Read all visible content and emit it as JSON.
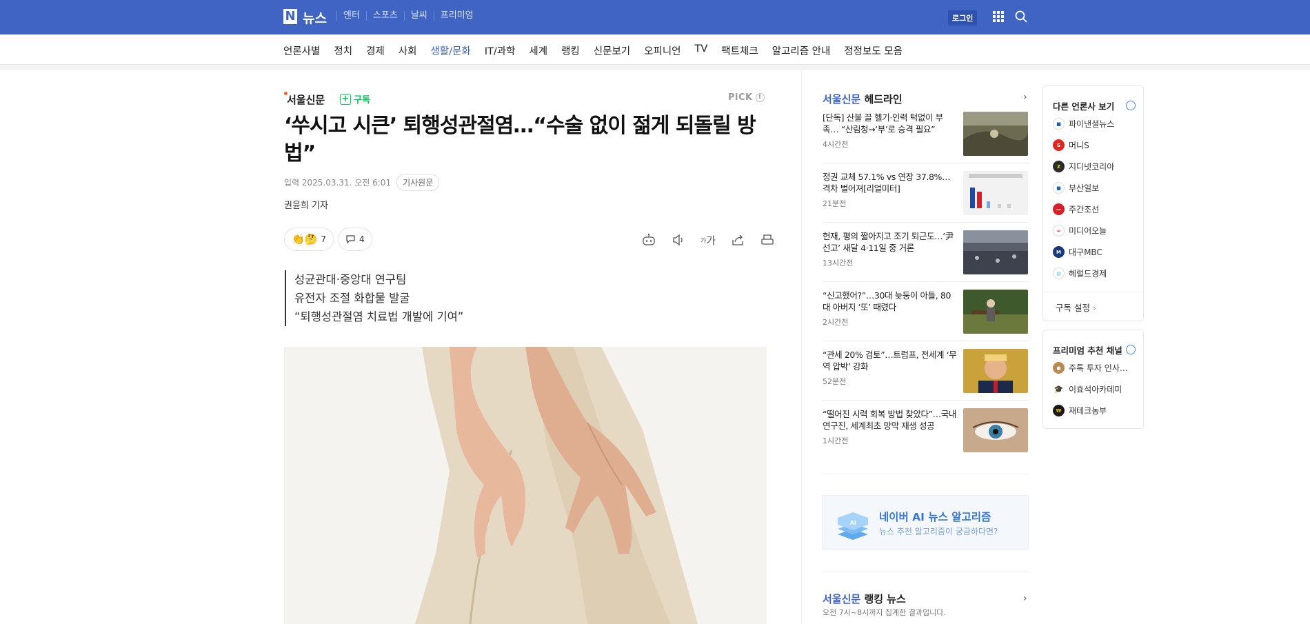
{
  "topbar": {
    "logo_letter": "N",
    "brand": "뉴스",
    "links": [
      "엔터",
      "스포츠",
      "날씨",
      "프리미엄"
    ],
    "login": "로그인"
  },
  "nav": {
    "items": [
      "언론사별",
      "정치",
      "경제",
      "사회",
      "생활/문화",
      "IT/과학",
      "세계",
      "랭킹",
      "신문보기",
      "오피니언",
      "TV",
      "팩트체크",
      "알고리즘 안내",
      "정정보도 모음"
    ],
    "active_index": 4
  },
  "article": {
    "press": "서울신문",
    "subscribe": "구독",
    "pick": "PiCK",
    "pick_info": "i",
    "headline": "‘쑤시고 시큰’ 퇴행성관절염…“수술 없이 젊게 되돌릴 방법”",
    "date": "입력 2025.03.31. 오전 6:01",
    "original_button": "기사원문",
    "reporter": "권윤희 기자",
    "reaction_count": "7",
    "comment_count": "4",
    "font_tool": "가",
    "font_tool_small": "가",
    "summary": [
      "성균관대·중앙대 연구팀",
      "유전자 조절 화합물 발굴",
      "“퇴행성관절염 치료법 개발에 기여”"
    ]
  },
  "headlines": {
    "press": "서울신문",
    "label": "헤드라인",
    "items": [
      {
        "text": "[단독] 산불 끌 헬기·인력 턱없이 부족… “산림청→‘부’로 승격 필요”",
        "time": "4시간전"
      },
      {
        "text": "정권 교체 57.1% vs 연장 37.8%…격차 벌어져[리얼미터]",
        "time": "21분전"
      },
      {
        "text": "헌재, 평의 짧아지고 조기 퇴근도…‘尹 선고’ 새달 4·11일 중 거론",
        "time": "13시간전"
      },
      {
        "text": "“신고했어?”…30대 늦둥이 아들, 80대 아버지 ‘또’ 때렸다",
        "time": "2시간전"
      },
      {
        "text": "“관세 20% 검토”…트럼프, 전세계 ‘무역 압박’ 강화",
        "time": "52분전"
      },
      {
        "text": "“떨어진 시력 회복 방법 찾았다”…국내 연구진, 세계최초 망막 재생 성공",
        "time": "1시간전"
      }
    ]
  },
  "ai_banner": {
    "title": "네이버 AI 뉴스 알고리즘",
    "subtitle": "뉴스 추천 알고리즘이 궁금하다면?",
    "icon_text": "AI"
  },
  "ranking": {
    "press": "서울신문",
    "label": "랭킹 뉴스",
    "subtitle": "오전 7시~8시까지 집계한 결과입니다."
  },
  "other_press": {
    "title": "다른 언론사 보기",
    "items": [
      {
        "name": "파이낸셜뉴스",
        "color": "#1c5ab8"
      },
      {
        "name": "머니S",
        "color": "#e0261f"
      },
      {
        "name": "지디넷코리아",
        "color": "#2b2b2b"
      },
      {
        "name": "부산일보",
        "color": "#1d63b8"
      },
      {
        "name": "주간조선",
        "color": "#d61f26"
      },
      {
        "name": "미디어오늘",
        "color": "#e53935"
      },
      {
        "name": "대구MBC",
        "color": "#1a3a7c"
      },
      {
        "name": "헤럴드경제",
        "color": "#5bb5e0"
      }
    ],
    "setting": "구독 설정"
  },
  "premium": {
    "title": "프리미엄 추천 채널",
    "items": [
      {
        "name": "주톡 투자 인사…",
        "color": "#b98a52"
      },
      {
        "name": "이효석아카데미",
        "color": "#2d3b55"
      },
      {
        "name": "재테크농부",
        "color": "#b38a00"
      }
    ]
  }
}
